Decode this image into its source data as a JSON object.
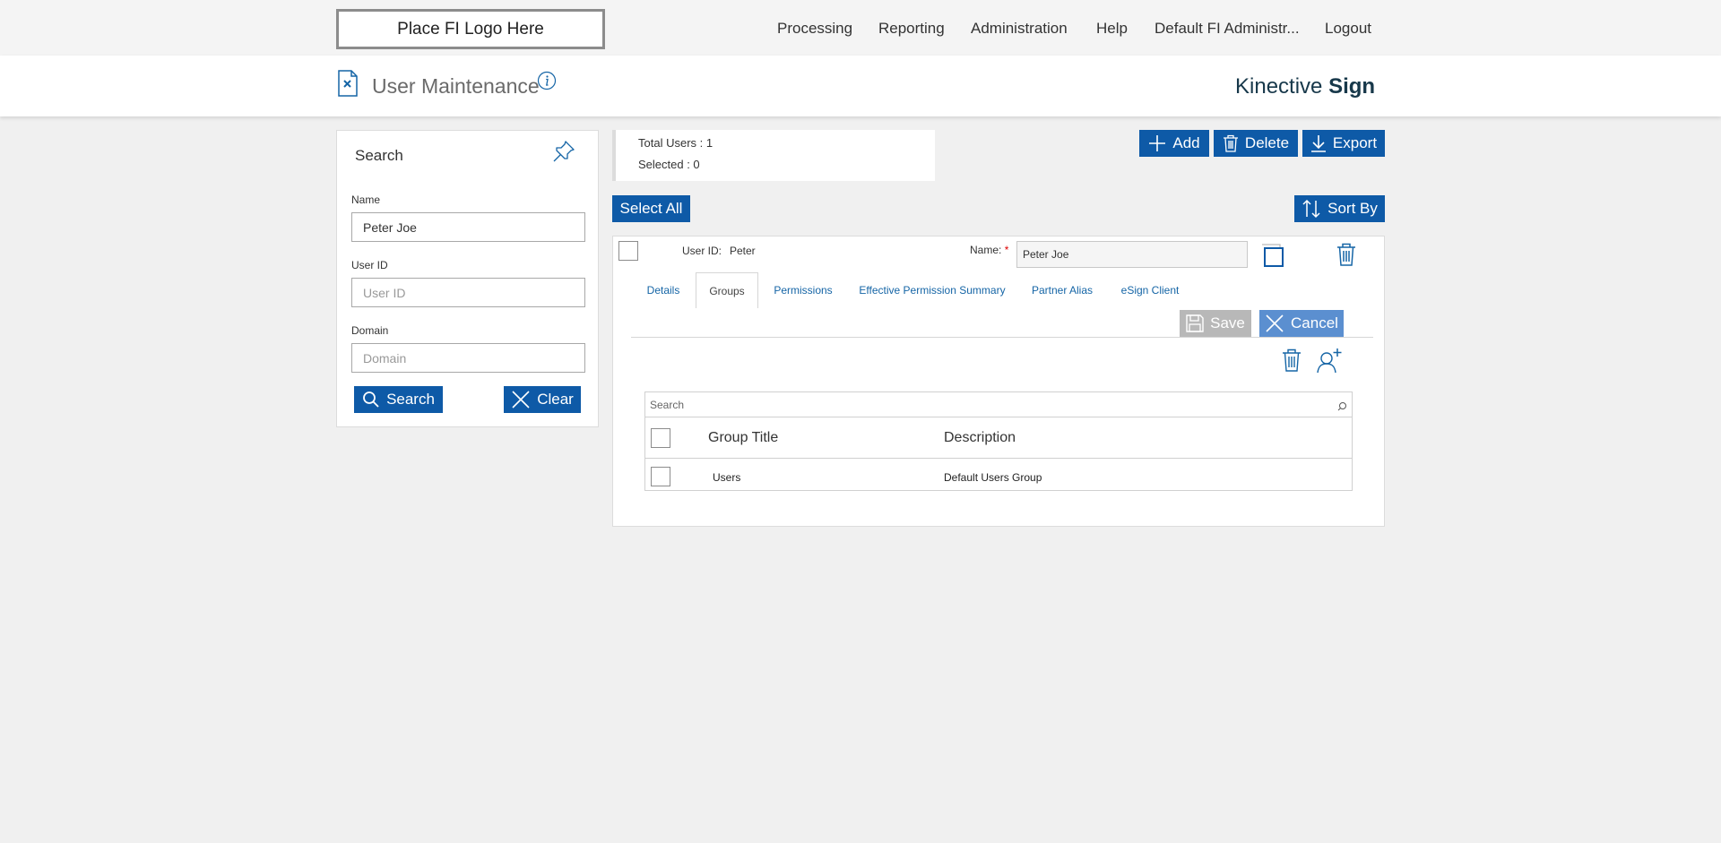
{
  "topbar": {
    "logo_text": "Place FI Logo Here",
    "nav": [
      "Processing",
      "Reporting",
      "Administration",
      "Help",
      "Default FI Administr...",
      "Logout"
    ]
  },
  "header": {
    "title": "User Maintenance",
    "brand_light": "Kinective",
    "brand_bold": "Sign"
  },
  "search_panel": {
    "title": "Search",
    "name_label": "Name",
    "name_value": "Peter Joe",
    "userid_label": "User ID",
    "userid_placeholder": "User ID",
    "domain_label": "Domain",
    "domain_placeholder": "Domain",
    "search_button": "Search",
    "clear_button": "Clear"
  },
  "summary": {
    "total_users": "Total Users : 1",
    "selected": "Selected : 0"
  },
  "toolbar": {
    "add": "Add",
    "delete": "Delete",
    "export": "Export",
    "select_all": "Select All",
    "sort_by": "Sort By"
  },
  "user_card": {
    "userid_label": "User ID:",
    "userid_value": "Peter",
    "name_label": "Name:",
    "required_mark": "*",
    "name_value": "Peter Joe",
    "tabs": [
      "Details",
      "Groups",
      "Permissions",
      "Effective Permission Summary",
      "Partner Alias",
      "eSign Client"
    ],
    "active_tab": "Groups",
    "save": "Save",
    "cancel": "Cancel"
  },
  "groups_grid": {
    "search_placeholder": "Search",
    "columns": [
      "Group Title",
      "Description"
    ],
    "rows": [
      {
        "title": "Users",
        "description": "Default Users Group"
      }
    ]
  },
  "colors": {
    "primary": "#0e5aa7",
    "disabled": "#b8b8b8",
    "cancel": "#5b8fd0",
    "link": "#1565a6",
    "brand": "#17384a"
  }
}
